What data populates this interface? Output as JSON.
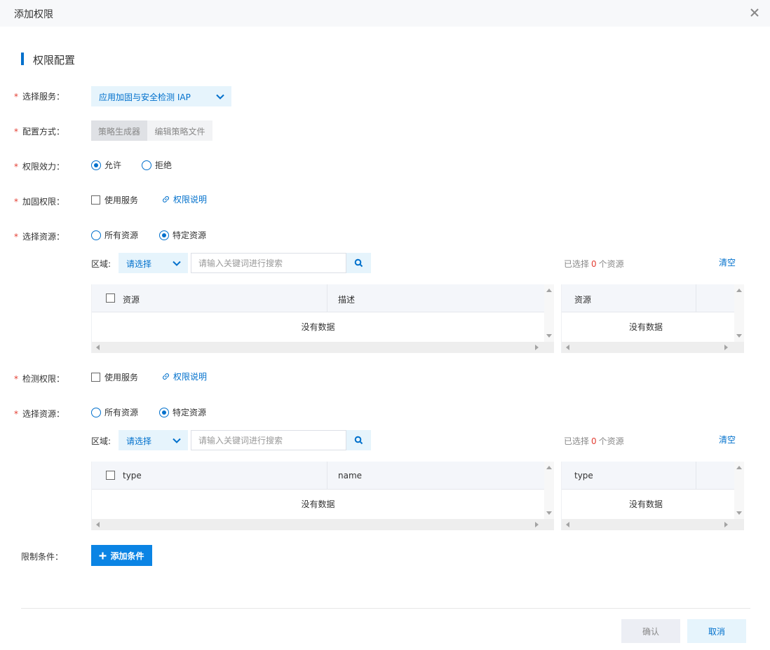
{
  "dialog": {
    "title": "添加权限"
  },
  "section": {
    "title": "权限配置"
  },
  "labels": {
    "service": "选择服务：",
    "config_method": "配置方式：",
    "effect": "权限效力：",
    "harden_permission": "加固权限：",
    "select_resource": "选择资源：",
    "detect_permission": "检测权限：",
    "conditions": "限制条件："
  },
  "service_select": {
    "value": "应用加固与安全检测 IAP"
  },
  "config_tabs": {
    "generator": "策略生成器",
    "edit_file": "编辑策略文件"
  },
  "effect": {
    "allow": "允许",
    "deny": "拒绝",
    "selected": "allow"
  },
  "harden": {
    "use_service": "使用服务",
    "doc_link": "权限说明",
    "resource_scope": {
      "all": "所有资源",
      "specific": "特定资源",
      "selected": "specific"
    },
    "region_label": "区域:",
    "region_select": "请选择",
    "search_placeholder": "请输入关键词进行搜索",
    "selected_prefix": "已选择",
    "selected_count": "0",
    "selected_suffix": "个资源",
    "clear": "清空",
    "left_columns": [
      "资源",
      "描述"
    ],
    "right_columns": [
      "资源"
    ],
    "empty_text": "没有数据"
  },
  "detect": {
    "use_service": "使用服务",
    "doc_link": "权限说明",
    "resource_scope": {
      "all": "所有资源",
      "specific": "特定资源",
      "selected": "specific"
    },
    "region_label": "区域:",
    "region_select": "请选择",
    "search_placeholder": "请输入关键词进行搜索",
    "selected_prefix": "已选择",
    "selected_count": "0",
    "selected_suffix": "个资源",
    "clear": "清空",
    "left_columns": [
      "type",
      "name"
    ],
    "right_columns": [
      "type"
    ],
    "empty_text": "没有数据"
  },
  "add_condition": "添加条件",
  "footer": {
    "confirm": "确认",
    "cancel": "取消"
  },
  "colors": {
    "primary": "#0070cc",
    "primary_button": "#0b84e4",
    "light_blue": "#e6f4fc",
    "required": "#e33e33"
  }
}
